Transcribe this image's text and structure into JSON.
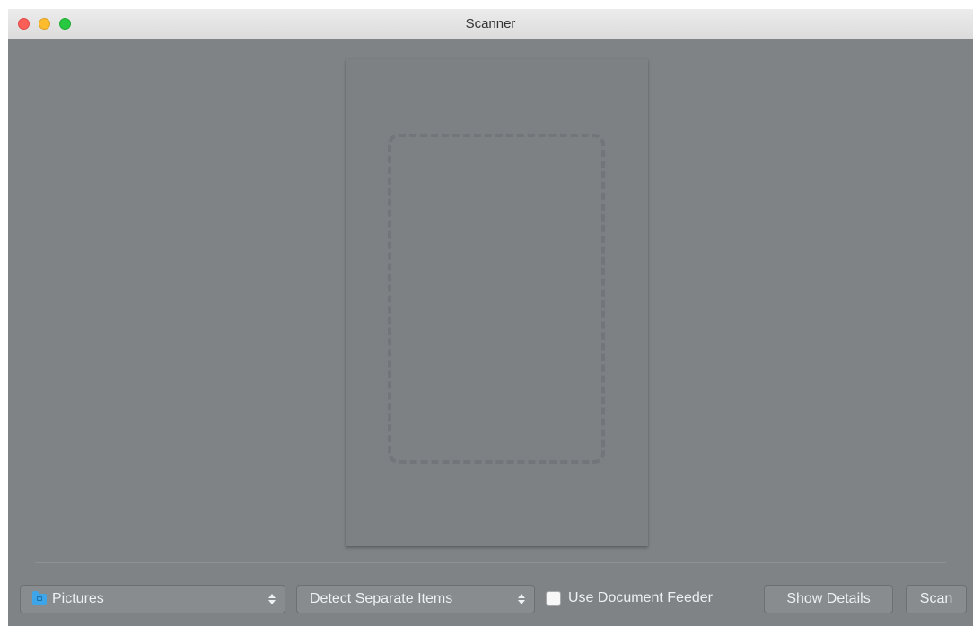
{
  "window": {
    "title": "Scanner"
  },
  "bottom_bar": {
    "destination_popup": {
      "value": "Pictures",
      "icon": "folder-icon"
    },
    "detect_popup": {
      "value": "Detect Separate Items"
    },
    "document_feeder": {
      "label": "Use Document Feeder",
      "checked": false
    },
    "show_details_label": "Show Details",
    "scan_label": "Scan"
  },
  "colors": {
    "background": "#7f8386",
    "close": "#fc5f57",
    "minimize": "#fdbc2e",
    "zoom": "#28c840",
    "folder_icon": "#3ea6e8"
  }
}
